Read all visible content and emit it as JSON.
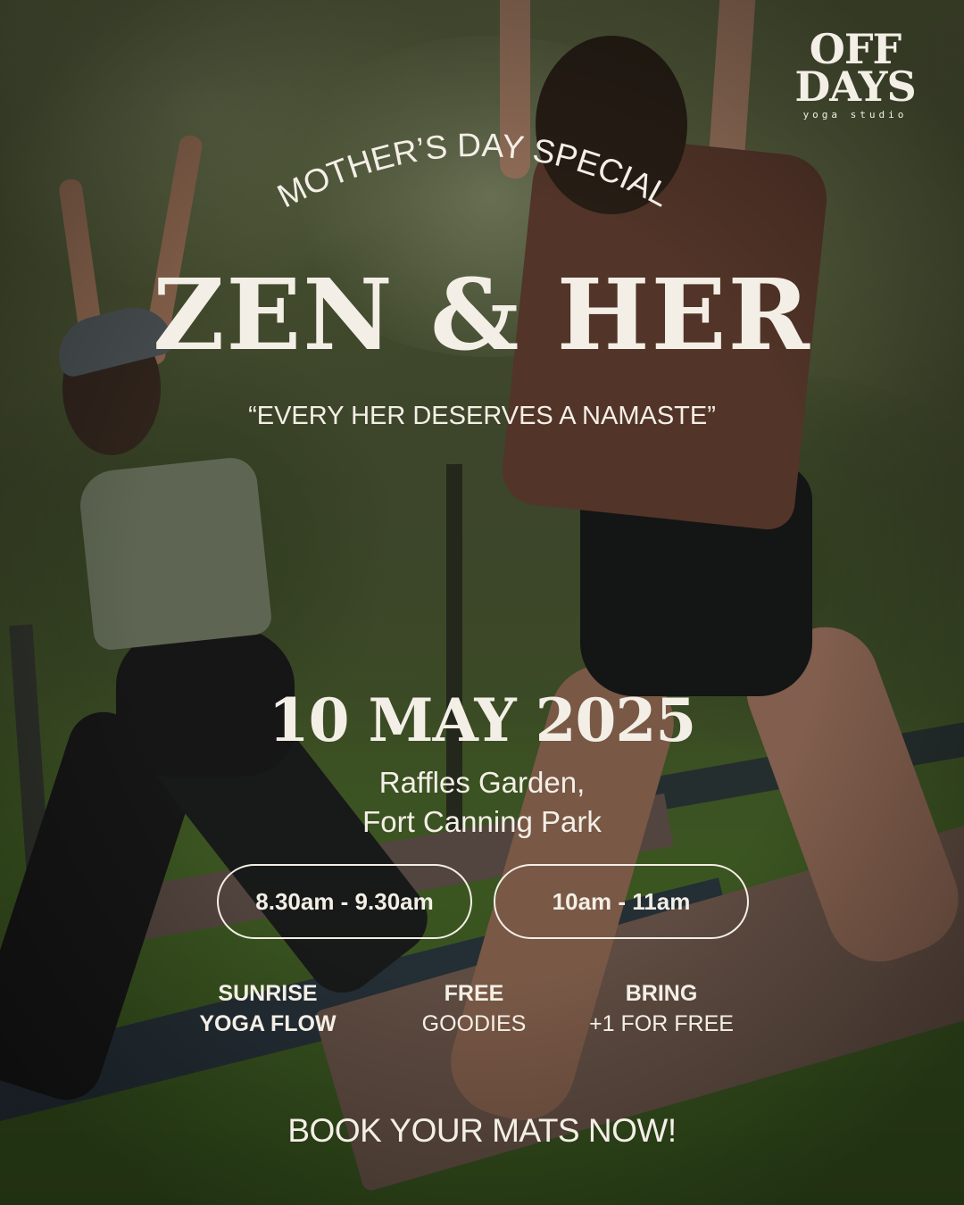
{
  "brand": {
    "logo_line1": "OFF",
    "logo_line2": "DAYS",
    "logo_sub": "yoga studio"
  },
  "event": {
    "kicker": "MOTHER’S DAY SPECIAL",
    "title": "ZEN & HER",
    "tagline": "“EVERY HER DESERVES A NAMASTE”",
    "date": "10 MAY 2025",
    "venue_line1": "Raffles Garden,",
    "venue_line2": "Fort Canning Park"
  },
  "sessions": [
    {
      "label": "8.30am - 9.30am"
    },
    {
      "label": "10am - 11am"
    }
  ],
  "features": [
    {
      "line1": "SUNRISE",
      "line2": "YOGA FLOW"
    },
    {
      "line1": "FREE",
      "line2": "GOODIES"
    },
    {
      "line1": "BRING",
      "line2": "+1 FOR FREE"
    }
  ],
  "cta": "BOOK YOUR MATS NOW!",
  "colors": {
    "text": "#f4efe6",
    "shirt": "#6e4233",
    "foliage": "#4e5a34"
  }
}
